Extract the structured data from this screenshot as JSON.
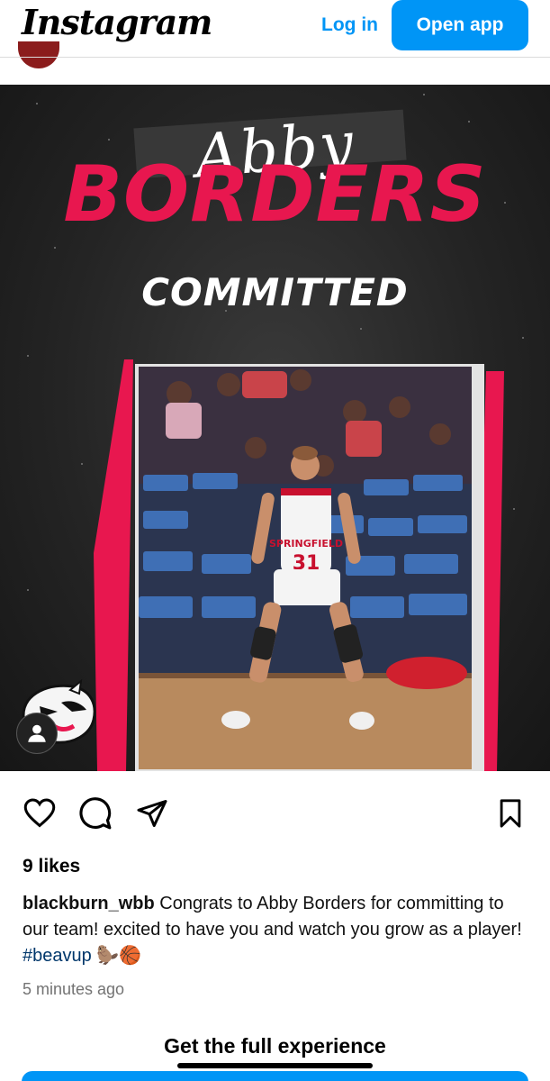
{
  "header": {
    "logo_text": "Instagram",
    "login_label": "Log in",
    "open_app_label": "Open app"
  },
  "post": {
    "graphic": {
      "first_name": "Abby",
      "last_name": "BORDERS",
      "status": "COMMITTED",
      "jersey_text": "SPRINGFIELD",
      "jersey_number": "31"
    },
    "likes": "9 likes",
    "caption": {
      "username": "blackburn_wbb",
      "text": "Congrats to Abby Borders for committing to our team! excited to have you and watch you grow as a player!",
      "hashtag": "#beavup",
      "emoji": "🦫🏀"
    },
    "timestamp": "5 minutes ago"
  },
  "footer": {
    "cta_title": "Get the full experience"
  },
  "icons": [
    "heart-icon",
    "comment-icon",
    "share-icon",
    "bookmark-icon",
    "user-tag-icon",
    "mascot-logo"
  ],
  "colors": {
    "brand_blue": "#0095f6",
    "accent_red": "#e8174f",
    "hashtag_blue": "#00376b"
  }
}
